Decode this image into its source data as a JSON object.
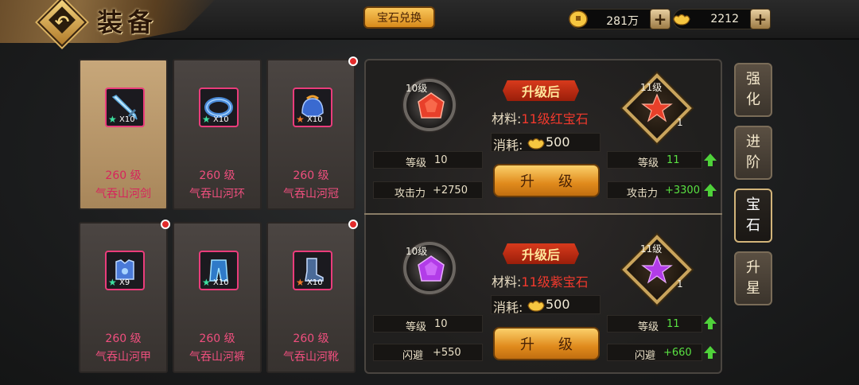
{
  "header": {
    "title": "装备",
    "exchange_label": "宝石兑换",
    "coins": "281万",
    "ingots": "2212",
    "plus": "+"
  },
  "equipment": [
    {
      "level": "260 级",
      "name": "气吞山河剑",
      "count": "X10",
      "star_color": "#3ee0a0",
      "red_dot": false,
      "selected": true,
      "icon": "sword-icon"
    },
    {
      "level": "260 级",
      "name": "气吞山河环",
      "count": "X10",
      "star_color": "#3ee0a0",
      "red_dot": false,
      "selected": false,
      "icon": "bracelet-icon"
    },
    {
      "level": "260 级",
      "name": "气吞山河冠",
      "count": "X10",
      "star_color": "#f07a2a",
      "red_dot": true,
      "selected": false,
      "icon": "helmet-icon"
    },
    {
      "level": "260 级",
      "name": "气吞山河甲",
      "count": "X9",
      "star_color": "#3ee0a0",
      "red_dot": true,
      "selected": false,
      "icon": "armor-icon"
    },
    {
      "level": "260 级",
      "name": "气吞山河裤",
      "count": "X10",
      "star_color": "#3ee0a0",
      "red_dot": false,
      "selected": false,
      "icon": "pants-icon"
    },
    {
      "level": "260 级",
      "name": "气吞山河靴",
      "count": "X10",
      "star_color": "#f07a2a",
      "red_dot": true,
      "selected": false,
      "icon": "boots-icon"
    }
  ],
  "gems": [
    {
      "current_level": "10级",
      "next_level": "11级",
      "next_count": "1",
      "after_label": "升级后",
      "material_prefix": "材料:",
      "material_name": "11级红宝石",
      "cost_label": "消耗:",
      "cost_value": "500",
      "level_label": "等级",
      "level_cur": "10",
      "level_next": "11",
      "stat_label": "攻击力",
      "stat_cur": "+2750",
      "stat_next": "+3300",
      "upgrade_label": "升级",
      "gem_color": "#e8402a"
    },
    {
      "current_level": "10级",
      "next_level": "11级",
      "next_count": "1",
      "after_label": "升级后",
      "material_prefix": "材料:",
      "material_name": "11级紫宝石",
      "cost_label": "消耗:",
      "cost_value": "500",
      "level_label": "等级",
      "level_cur": "10",
      "level_next": "11",
      "stat_label": "闪避",
      "stat_cur": "+550",
      "stat_next": "+660",
      "upgrade_label": "升级",
      "gem_color": "#b23ce8"
    }
  ],
  "tabs": [
    {
      "label": "强化",
      "active": false
    },
    {
      "label": "进阶",
      "active": false
    },
    {
      "label": "宝石",
      "active": true
    },
    {
      "label": "升星",
      "active": false
    }
  ]
}
